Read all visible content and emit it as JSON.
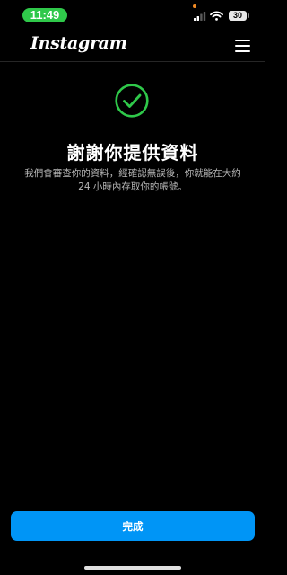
{
  "status_bar": {
    "time": "11:49",
    "battery_level": "30",
    "icons": [
      "signal-icon",
      "wifi-icon",
      "battery-icon"
    ]
  },
  "header": {
    "logo_text": "Instagram",
    "menu_icon": "hamburger-menu-icon"
  },
  "main": {
    "status_icon": "check-circle-icon",
    "title": "謝謝你提供資料",
    "description": "我們會審查你的資料，經確認無誤後，你就能在大約 24 小時內存取你的帳號。"
  },
  "footer": {
    "done_label": "完成"
  },
  "colors": {
    "background": "#000000",
    "accent_green": "#2fc84a",
    "button_blue": "#0095f6",
    "secondary_text": "#b7b7b7"
  }
}
